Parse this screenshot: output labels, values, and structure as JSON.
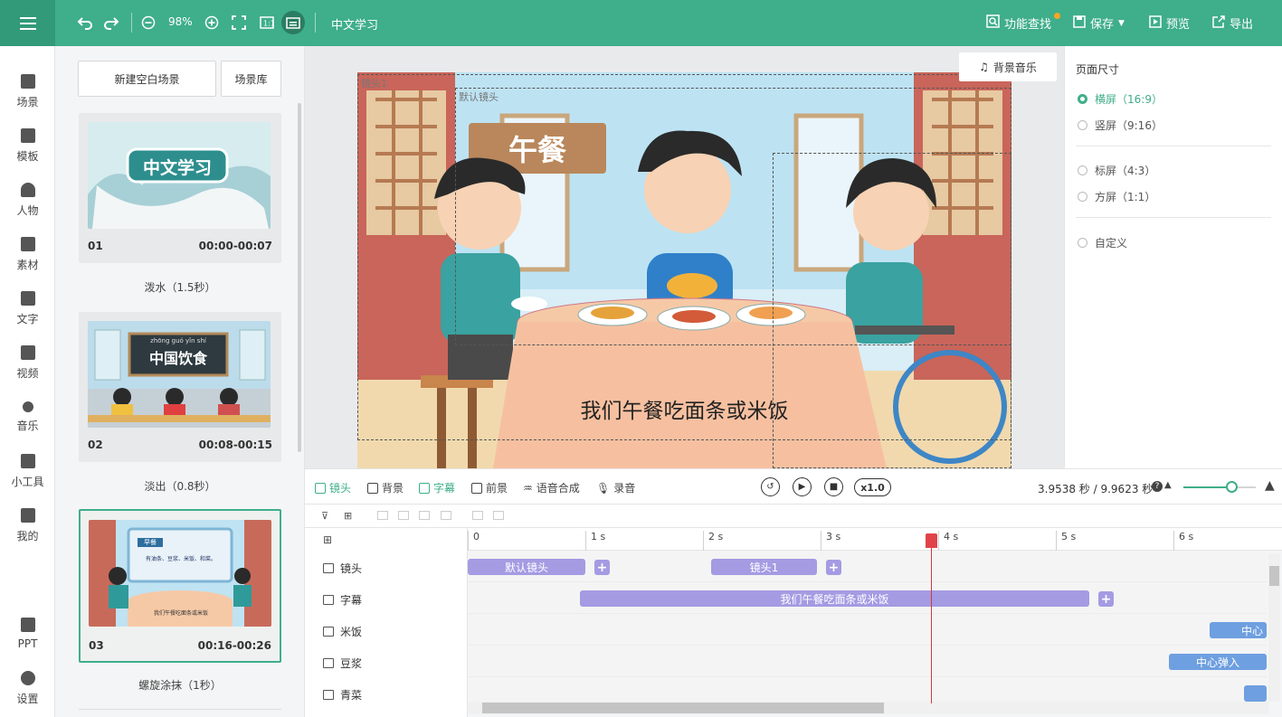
{
  "topbar": {
    "zoom": "98%",
    "project_title": "中文学习",
    "find_label": "功能查找",
    "save_label": "保存",
    "preview_label": "预览",
    "export_label": "导出"
  },
  "nav": [
    {
      "label": "场景",
      "icon": "scene-icon"
    },
    {
      "label": "模板",
      "icon": "template-icon"
    },
    {
      "label": "人物",
      "icon": "person-icon"
    },
    {
      "label": "素材",
      "icon": "material-icon"
    },
    {
      "label": "文字",
      "icon": "text-icon"
    },
    {
      "label": "视频",
      "icon": "video-icon"
    },
    {
      "label": "音乐",
      "icon": "music-icon"
    },
    {
      "label": "小工具",
      "icon": "toolbox-icon"
    },
    {
      "label": "我的",
      "icon": "upload-icon"
    },
    {
      "label": "PPT",
      "icon": "ppt-icon"
    },
    {
      "label": "设置",
      "icon": "settings-icon"
    }
  ],
  "scenes": {
    "new_blank": "新建空白场景",
    "library": "场景库",
    "items": [
      {
        "num": "01",
        "time": "00:00-00:07",
        "transition": "泼水（1.5秒）",
        "thumb_text": "中文学习"
      },
      {
        "num": "02",
        "time": "00:08-00:15",
        "transition": "淡出（0.8秒）",
        "thumb_text": "中国饮食",
        "pinyin": "zhōng guó yǐn shí"
      },
      {
        "num": "03",
        "time": "00:16-00:26",
        "transition": "螺旋涂抹（1秒）",
        "thumb_text": "早餐",
        "thumb_sub": "有油条、豆浆、米饭、和菜。",
        "thumb_caption": "我们午餐吃面条或米饭"
      }
    ]
  },
  "canvas": {
    "bgm_label": "背景音乐",
    "lens1_label": "镜头1",
    "default_lens_label": "默认镜头",
    "sign_text": "午餐",
    "caption": "我们午餐吃面条或米饭"
  },
  "page_size": {
    "title": "页面尺寸",
    "options": [
      {
        "label": "横屏（16:9）",
        "selected": true
      },
      {
        "label": "竖屏（9:16）",
        "selected": false
      },
      {
        "label": "标屏（4:3）",
        "selected": false
      },
      {
        "label": "方屏（1:1）",
        "selected": false
      },
      {
        "label": "自定义",
        "selected": false
      }
    ]
  },
  "timeline": {
    "tabs": [
      "镜头",
      "背景",
      "字幕",
      "前景",
      "语音合成",
      "录音"
    ],
    "active_tabs": [
      "镜头",
      "字幕"
    ],
    "speed": "x1.0",
    "time_readout": "3.9538 秒 / 9.9623 秒",
    "ruler": [
      "0",
      "1 s",
      "2 s",
      "3 s",
      "4 s",
      "5 s",
      "6 s"
    ],
    "tracks": [
      {
        "label": "镜头",
        "clips": [
          "默认镜头",
          "镜头1"
        ]
      },
      {
        "label": "字幕",
        "clips": [
          "我们午餐吃面条或米饭"
        ]
      },
      {
        "label": "米饭",
        "clips": [
          "中心"
        ]
      },
      {
        "label": "豆浆",
        "clips": [
          "中心弹入"
        ]
      },
      {
        "label": "青菜",
        "clips": [
          ""
        ]
      }
    ],
    "playhead_seconds": 3.9538,
    "total_seconds": 9.9623
  },
  "colors": {
    "accent": "#3fae8a",
    "clip_purple": "#a49be3",
    "clip_blue": "#6e9fe0",
    "playhead": "#d0383c"
  }
}
